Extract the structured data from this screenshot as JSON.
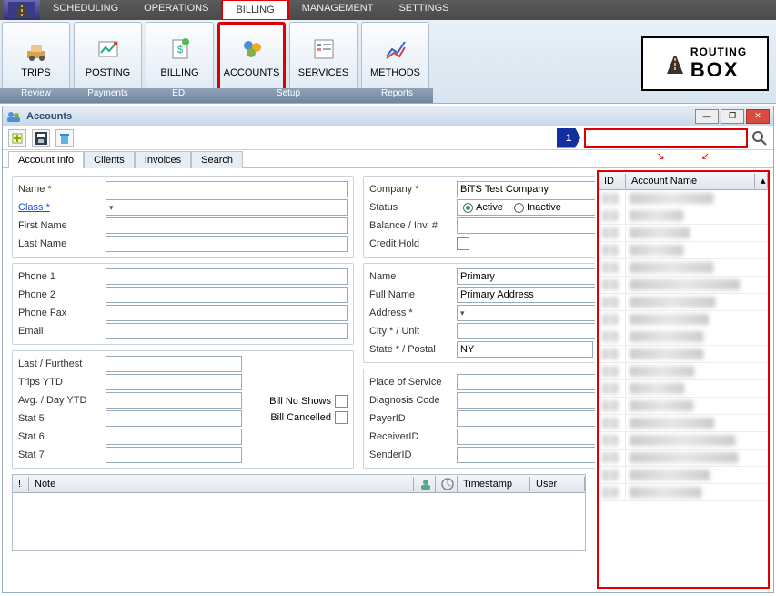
{
  "menu": {
    "items": [
      "SCHEDULING",
      "OPERATIONS",
      "BILLING",
      "MANAGEMENT",
      "SETTINGS"
    ],
    "active": "BILLING"
  },
  "ribbon": {
    "buttons": [
      {
        "label": "TRIPS",
        "icon": "trips"
      },
      {
        "label": "POSTING",
        "icon": "posting"
      },
      {
        "label": "BILLING",
        "icon": "billing"
      },
      {
        "label": "ACCOUNTS",
        "icon": "accounts",
        "active": true
      },
      {
        "label": "SERVICES",
        "icon": "services"
      },
      {
        "label": "METHODS",
        "icon": "methods"
      }
    ],
    "groups": [
      "Review",
      "Payments",
      "EDI",
      "Setup",
      "Reports"
    ],
    "logo": {
      "line1": "ROUTING",
      "line2": "BOX"
    }
  },
  "window": {
    "title": "Accounts"
  },
  "callout": "1",
  "tabs": [
    "Account Info",
    "Clients",
    "Invoices",
    "Search"
  ],
  "left": {
    "name_label": "Name",
    "class_label": "Class",
    "firstname_label": "First Name",
    "lastname_label": "Last Name",
    "phone1": "Phone 1",
    "phone2": "Phone 2",
    "phonefax": "Phone Fax",
    "email": "Email",
    "lastfurthest": "Last / Furthest",
    "tripsytd": "Trips YTD",
    "avgday": "Avg. / Day YTD",
    "stat5": "Stat 5",
    "stat6": "Stat 6",
    "stat7": "Stat 7",
    "billnoshows": "Bill No Shows",
    "billcancelled": "Bill Cancelled"
  },
  "right": {
    "company_label": "Company",
    "company_value": "BiTS Test Company",
    "status_label": "Status",
    "status_active": "Active",
    "status_inactive": "Inactive",
    "status_value": "Active",
    "balance_label": "Balance / Inv. #",
    "credithold_label": "Credit Hold",
    "addr_name_label": "Name",
    "addr_name_value": "Primary",
    "fullname_label": "Full Name",
    "fullname_value": "Primary Address",
    "address_label": "Address",
    "city_label": "City * / Unit",
    "state_label": "State * / Postal",
    "state_value": "NY",
    "pos": "Place of Service",
    "diag": "Diagnosis Code",
    "payer": "PayerID",
    "receiver": "ReceiverID",
    "sender": "SenderID"
  },
  "notes": {
    "bang": "!",
    "note": "Note",
    "timestamp": "Timestamp",
    "user": "User"
  },
  "sidecols": {
    "id": "ID",
    "name": "Account Name"
  },
  "side_rows": 18
}
